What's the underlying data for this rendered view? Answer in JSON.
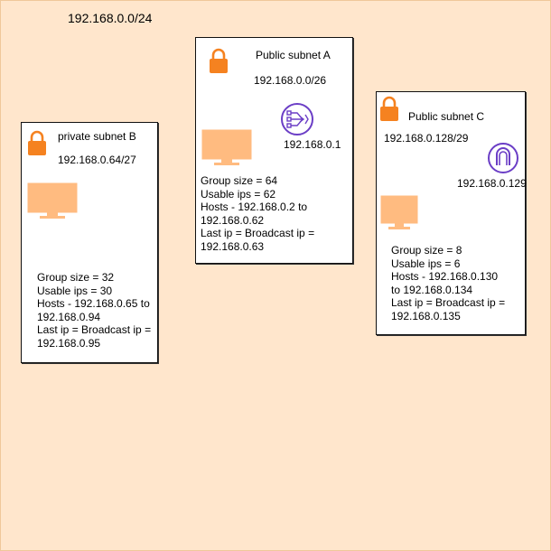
{
  "vpc": {
    "cidr": "192.168.0.0/24"
  },
  "subnets": {
    "a": {
      "title": "Public subnet  A",
      "cidr": "192.168.0.0/26",
      "gateway_ip": "192.168.0.1",
      "gateway_icon": "nat-gateway-icon",
      "info": [
        "Group size = 64",
        "Usable ips = 62",
        "Hosts - 192.168.0.2 to",
        "192.168.0.62",
        "Last ip = Broadcast ip =",
        "192.168.0.63"
      ]
    },
    "b": {
      "title": "private subnet B",
      "cidr": "192.168.0.64/27",
      "info": [
        "Group size = 32",
        "Usable ips = 30",
        "Hosts - 192.168.0.65 to",
        "192.168.0.94",
        "Last ip = Broadcast ip =",
        "192.168.0.95"
      ]
    },
    "c": {
      "title": "Public subnet  C",
      "cidr": "192.168.0.128/29",
      "gateway_ip": "192.168.0.129",
      "gateway_icon": "internet-gateway-icon",
      "info": [
        "Group size = 8",
        "Usable ips = 6",
        "Hosts - 192.168.0.130",
        "to 192.168.0.134",
        "Last ip = Broadcast ip =",
        "192.168.0.135"
      ]
    }
  },
  "colors": {
    "background": "#ffe6cc",
    "lock": "#f58220",
    "monitor": "#ffbb80",
    "gateway": "#6b3ec6"
  }
}
